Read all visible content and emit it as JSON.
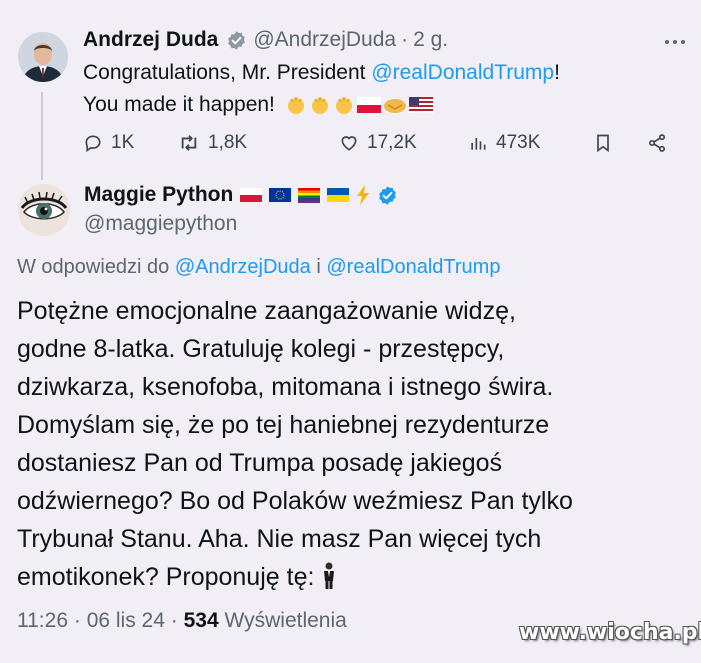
{
  "tweet1": {
    "author_name": "Andrzej Duda",
    "handle": "@AndrzejDuda",
    "separator": "·",
    "age": "2 g.",
    "line1_text": "Congratulations, Mr. President ",
    "line1_mention": "@realDonaldTrump",
    "line1_end": "!",
    "line2_text": "You made it happen!",
    "actions": {
      "replies": "1K",
      "reposts": "1,8K",
      "likes": "17,2K",
      "views": "473K"
    }
  },
  "tweet2": {
    "author_name": "Maggie Python",
    "handle": "@maggiepython",
    "reply_prefix": "W odpowiedzi do ",
    "reply_mention1": "@AndrzejDuda",
    "reply_joiner": " i ",
    "reply_mention2": "@realDonaldTrump",
    "body_lines": [
      "Potężne emocjonalne zaangażowanie widzę,",
      "godne 8-latka. Gratuluję kolegi - przestępcy,",
      "dziwkarza, ksenofoba, mitomana i istnego świra.",
      "Domyślam się, że po tej haniebnej rezydenturze",
      "dostaniesz Pan od Trumpa posadę jakiegoś",
      "odźwiernego? Bo od Polaków weźmiesz Pan tylko",
      "Trybunał Stanu. Aha. Nie masz Pan więcej tych",
      "emotikonek? Proponuję tę: "
    ],
    "time": "11:26",
    "date": "06 lis 24",
    "views_count": "534",
    "views_label": "Wyświetlenia"
  },
  "watermark": "www.wiocha.pl",
  "colors": {
    "background": "#f1eef6",
    "link": "#1d9bf0",
    "secondary_text": "#5b6670",
    "verified_badge": "#1d9bf0"
  }
}
